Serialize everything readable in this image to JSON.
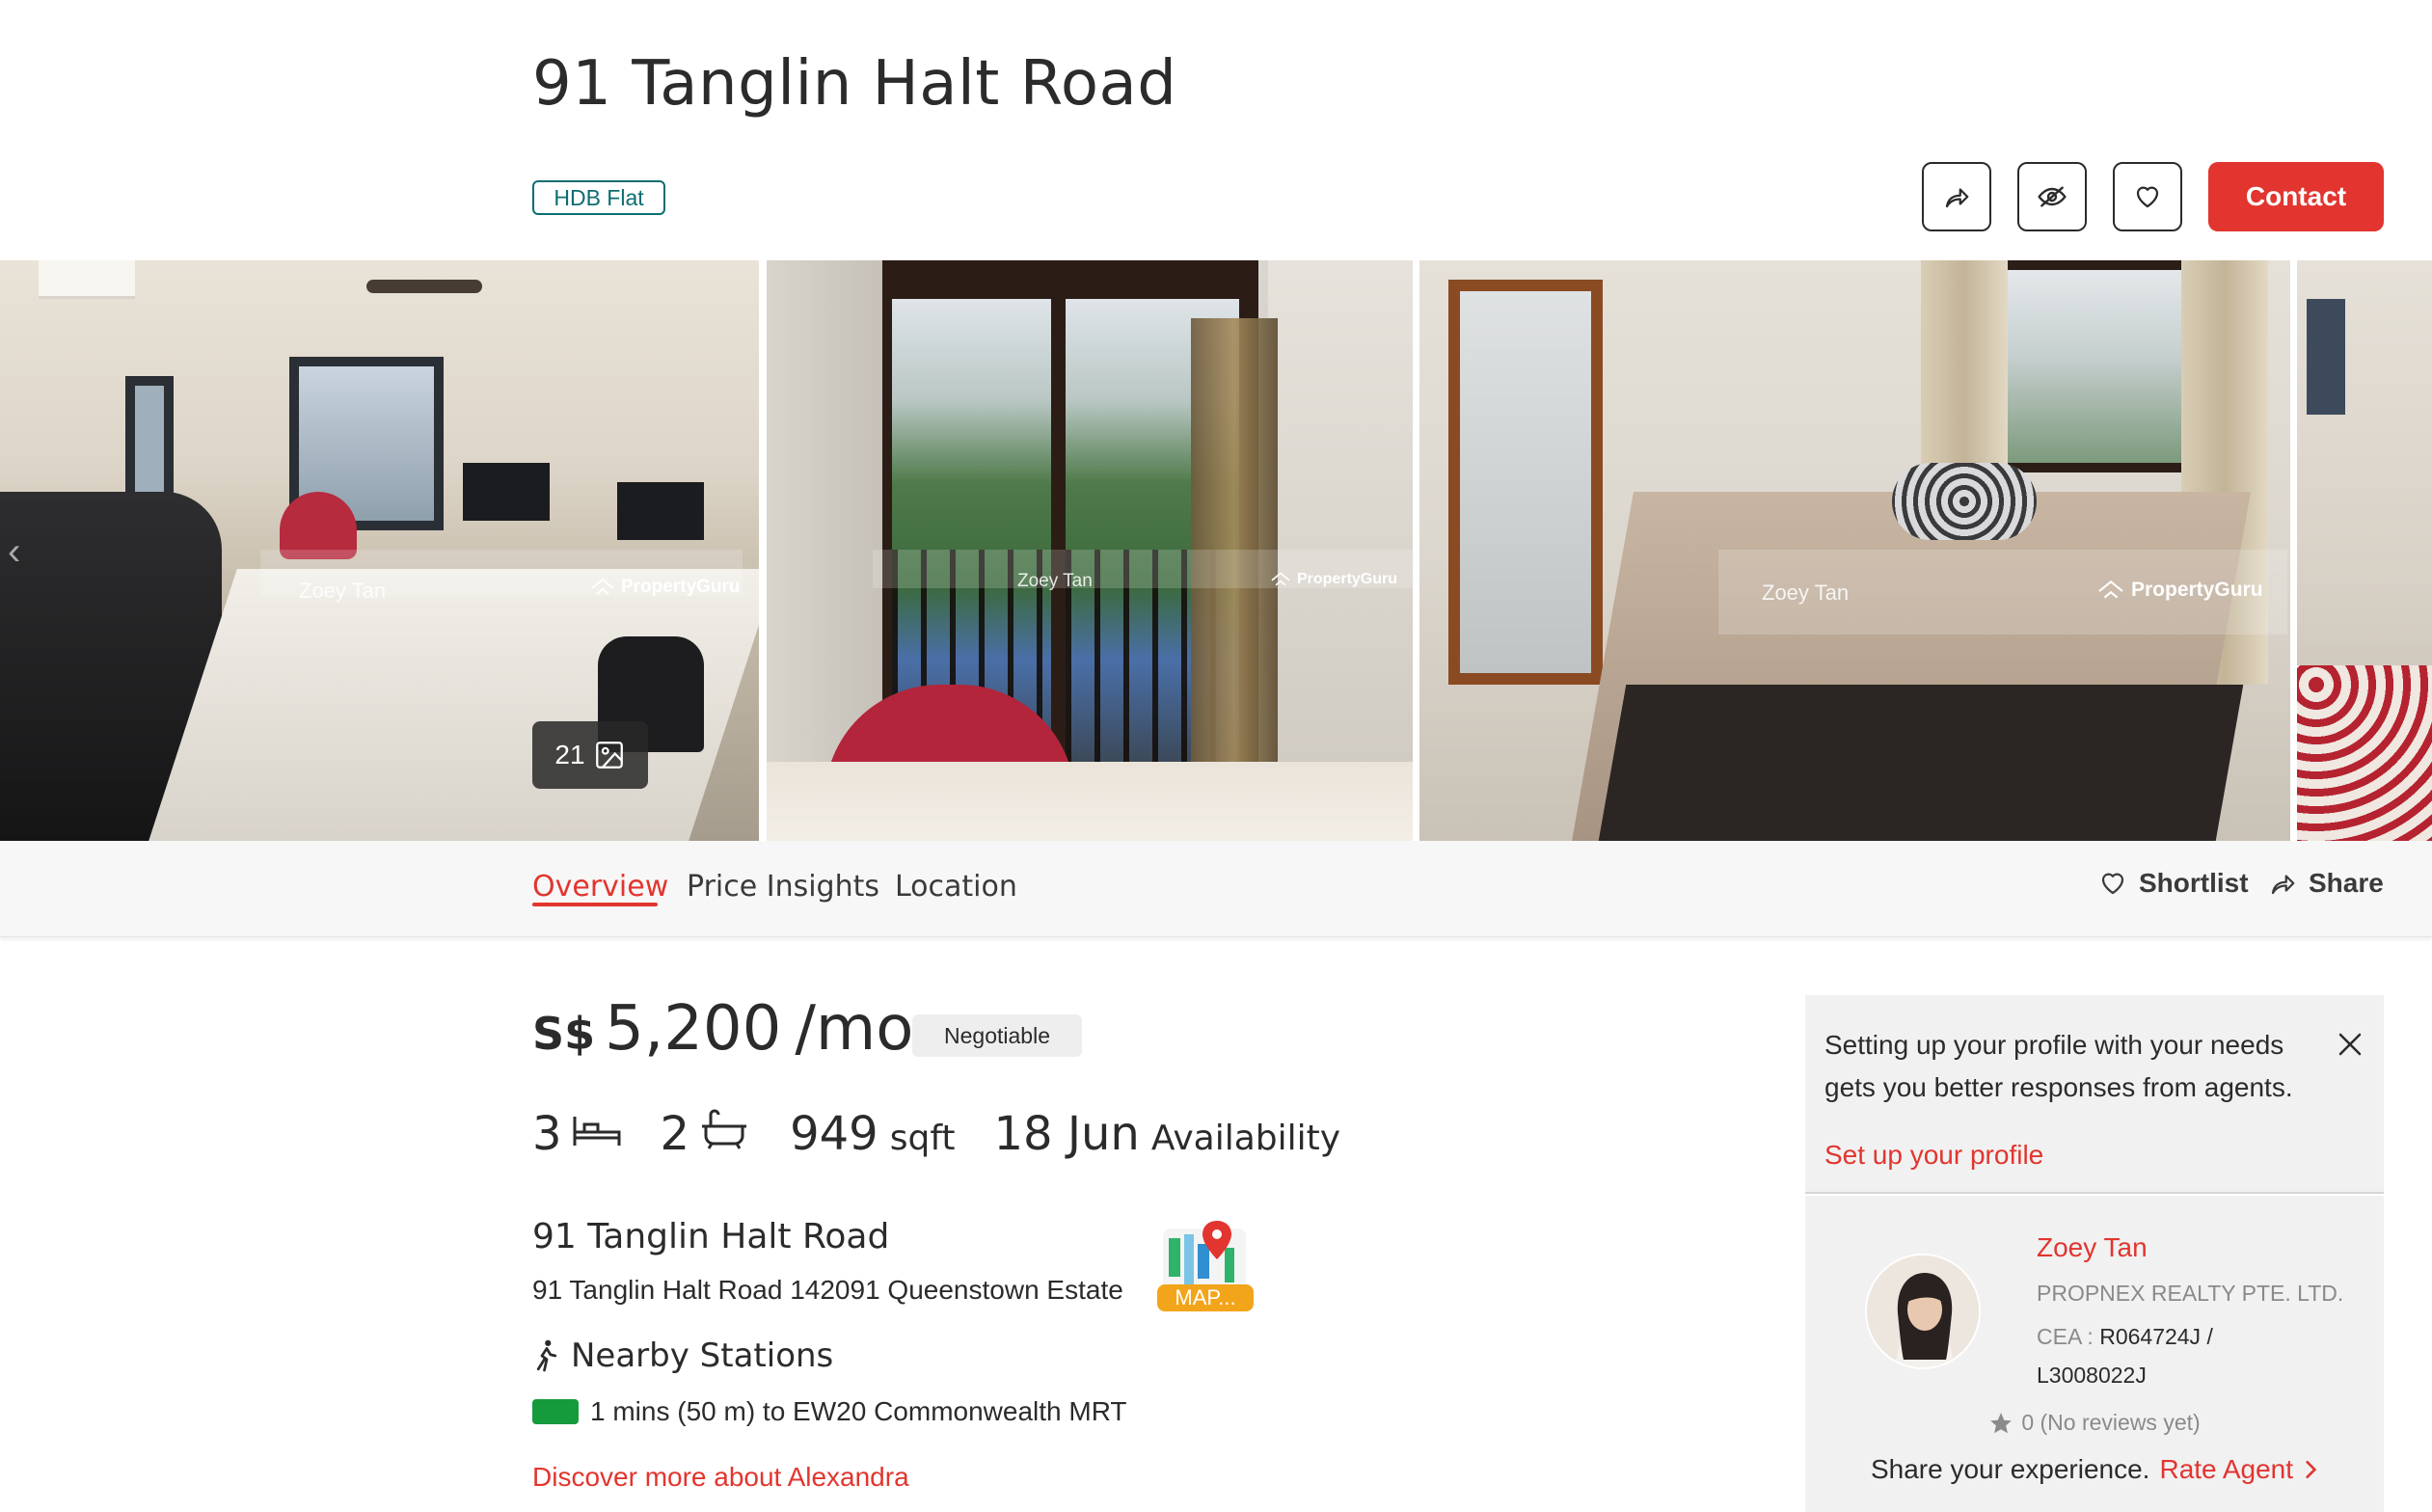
{
  "listing": {
    "title": "91 Tanglin Halt Road",
    "type_badge": "HDB Flat"
  },
  "header_actions": {
    "contact_label": "Contact"
  },
  "gallery": {
    "photo_count": "21",
    "watermark_agent": "Zoey Tan",
    "watermark_brand": "PropertyGuru"
  },
  "tabs": [
    {
      "label": "Overview",
      "active": true
    },
    {
      "label": "Price Insights",
      "active": false
    },
    {
      "label": "Location",
      "active": false
    }
  ],
  "tab_actions": {
    "shortlist": "Shortlist",
    "share": "Share"
  },
  "price": {
    "currency": "S$",
    "amount": "5,200",
    "unit": "/mo",
    "negotiable": "Negotiable"
  },
  "specs": {
    "bedrooms": "3",
    "bathrooms": "2",
    "area": "949",
    "area_unit": "sqft",
    "availability_date": "18 Jun",
    "availability_label": "Availability"
  },
  "address": {
    "title": "91 Tanglin Halt Road",
    "line": "91 Tanglin Halt Road 142091 Queenstown Estate",
    "map_label": "MAP..."
  },
  "nearby": {
    "title": "Nearby Stations",
    "stations": [
      {
        "text": "1 mins (50 m) to EW20 Commonwealth MRT",
        "line_color": "#159a3c"
      }
    ],
    "discover_link": "Discover more about Alexandra"
  },
  "profile_prompt": {
    "text": "Setting up your profile with your needs gets you better responses from agents.",
    "link": "Set up your profile"
  },
  "agent": {
    "name": "Zoey Tan",
    "agency": "PROPNEX REALTY PTE. LTD.",
    "cea_label": "CEA : ",
    "cea_value": "R064724J / L3008022J",
    "reviews": "0 (No reviews yet)",
    "share_prompt": "Share your experience.",
    "rate_link": "Rate Agent"
  },
  "colors": {
    "accent": "#e2352f",
    "badge": "#0d6e70",
    "mrt_green": "#159a3c"
  }
}
